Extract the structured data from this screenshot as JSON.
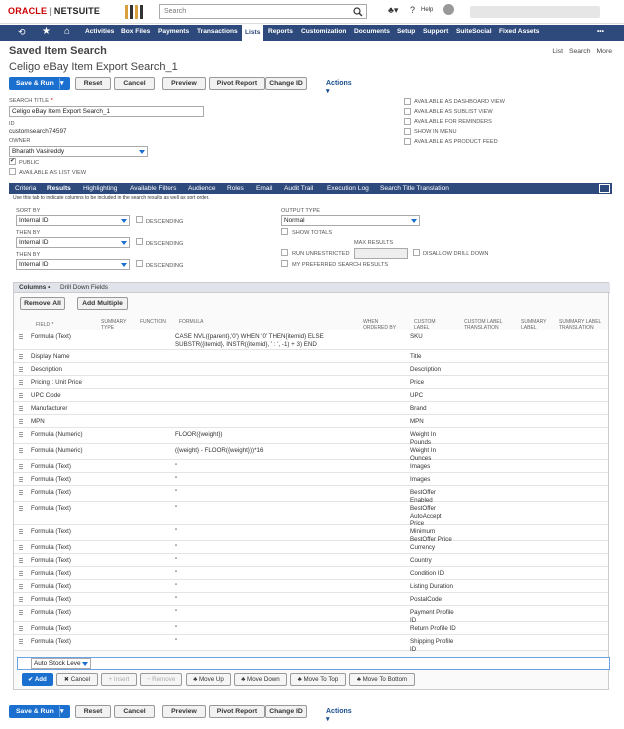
{
  "header": {
    "logo_oracle": "ORACLE",
    "logo_sep": "|",
    "logo_netsuite": "NETSUITE",
    "search_placeholder": "Search",
    "help_label": "Help"
  },
  "nav": {
    "items": [
      "Activities",
      "Box Files",
      "Payments",
      "Transactions",
      "Lists",
      "Reports",
      "Customization",
      "Documents",
      "Setup",
      "Support",
      "SuiteSocial",
      "Fixed Assets"
    ],
    "active": "Lists",
    "more": "•••"
  },
  "page": {
    "title": "Saved Item Search",
    "links": [
      "List",
      "Search",
      "More"
    ],
    "search_name": "Celigo eBay Item Export Search_1"
  },
  "toolbar": {
    "save_run": "Save & Run",
    "reset": "Reset",
    "cancel": "Cancel",
    "preview": "Preview",
    "pivot": "Pivot Report",
    "change_id": "Change ID",
    "actions": "Actions ▾"
  },
  "form": {
    "search_title_label": "SEARCH TITLE",
    "required_mark": "*",
    "search_title_value": "Celigo eBay Item Export Search_1",
    "id_label": "ID",
    "id_value": "customsearch74597",
    "owner_label": "OWNER",
    "owner_value": "Bharath Vasireddy",
    "public_label": "PUBLIC",
    "list_view_label": "AVAILABLE AS LIST VIEW",
    "right_checks": [
      "AVAILABLE AS DASHBOARD VIEW",
      "AVAILABLE AS SUBLIST VIEW",
      "AVAILABLE FOR REMINDERS",
      "SHOW IN MENU",
      "AVAILABLE AS PRODUCT FEED"
    ]
  },
  "subtabs": {
    "items": [
      "Criteria",
      "Results",
      "Highlighting",
      "Available Filters",
      "Audience",
      "Roles",
      "Email",
      "Audit Trail",
      "Execution Log",
      "Search Title Translation"
    ],
    "active": "Results",
    "note": "Use this tab to indicate columns to be included in the search results as well as sort order."
  },
  "results": {
    "sort_by_label": "SORT BY",
    "then_by_label": "THEN BY",
    "sort_value": "Internal ID",
    "descending_label": "DESCENDING",
    "output_type_label": "OUTPUT TYPE",
    "output_type_value": "Normal",
    "show_totals_label": "SHOW TOTALS",
    "run_unrestricted_label": "RUN UNRESTRICTED",
    "max_results_label": "MAX RESULTS",
    "disallow_label": "DISALLOW DRILL DOWN",
    "preferred_label": "MY PREFERRED SEARCH RESULTS"
  },
  "columns_panel": {
    "tabs": [
      "Columns •",
      "Drill Down Fields"
    ],
    "remove_all": "Remove All",
    "add_multiple": "Add Multiple",
    "headers": [
      "FIELD *",
      "SUMMARY TYPE",
      "FUNCTION",
      "FORMULA",
      "WHEN ORDERED BY FIELD",
      "CUSTOM LABEL",
      "CUSTOM LABEL TRANSLATION",
      "SUMMARY LABEL",
      "SUMMARY LABEL TRANSLATION"
    ],
    "rows": [
      {
        "field": "Formula (Text)",
        "formula": "CASE NVL({parent},'0') WHEN '0' THEN{itemid} ELSE SUBSTR({itemid}, INSTR({itemid}, ' : ', -1) + 3) END",
        "label": "SKU"
      },
      {
        "field": "Display Name",
        "formula": "",
        "label": "Title"
      },
      {
        "field": "Description",
        "formula": "",
        "label": "Description"
      },
      {
        "field": "Pricing : Unit Price",
        "formula": "",
        "label": "Price"
      },
      {
        "field": "UPC Code",
        "formula": "",
        "label": "UPC"
      },
      {
        "field": "Manufacturer",
        "formula": "",
        "label": "Brand"
      },
      {
        "field": "MPN",
        "formula": "",
        "label": "MPN"
      },
      {
        "field": "Formula (Numeric)",
        "formula": "FLOOR({weight})",
        "label": "Weight In Pounds"
      },
      {
        "field": "Formula (Numeric)",
        "formula": "({weight} - FLOOR({weight}))*16",
        "label": "Weight In Ounces"
      },
      {
        "field": "Formula (Text)",
        "formula": "''",
        "label": "Images"
      },
      {
        "field": "Formula (Text)",
        "formula": "''",
        "label": "Images"
      },
      {
        "field": "Formula (Text)",
        "formula": "''",
        "label": "BestOffer Enabled"
      },
      {
        "field": "Formula (Text)",
        "formula": "''",
        "label": "BestOffer AutoAccept Price"
      },
      {
        "field": "Formula (Text)",
        "formula": "''",
        "label": "Minimum BestOffer Price"
      },
      {
        "field": "Formula (Text)",
        "formula": "''",
        "label": "Currency"
      },
      {
        "field": "Formula (Text)",
        "formula": "''",
        "label": "Country"
      },
      {
        "field": "Formula (Text)",
        "formula": "''",
        "label": "Condition ID"
      },
      {
        "field": "Formula (Text)",
        "formula": "''",
        "label": "Listing Duration"
      },
      {
        "field": "Formula (Text)",
        "formula": "''",
        "label": "PostalCode"
      },
      {
        "field": "Formula (Text)",
        "formula": "''",
        "label": "Payment Profile ID"
      },
      {
        "field": "Formula (Text)",
        "formula": "''",
        "label": "Return Profile ID"
      },
      {
        "field": "Formula (Text)",
        "formula": "''",
        "label": "Shipping Profile ID"
      }
    ],
    "edit_value": "Auto Stock Leve",
    "tools": [
      "✔ Add",
      "✖ Cancel",
      "+ Insert",
      "− Remove",
      "♣ Move Up",
      "♣ Move Down",
      "♣ Move To Top",
      "♣ Move To Bottom"
    ]
  }
}
